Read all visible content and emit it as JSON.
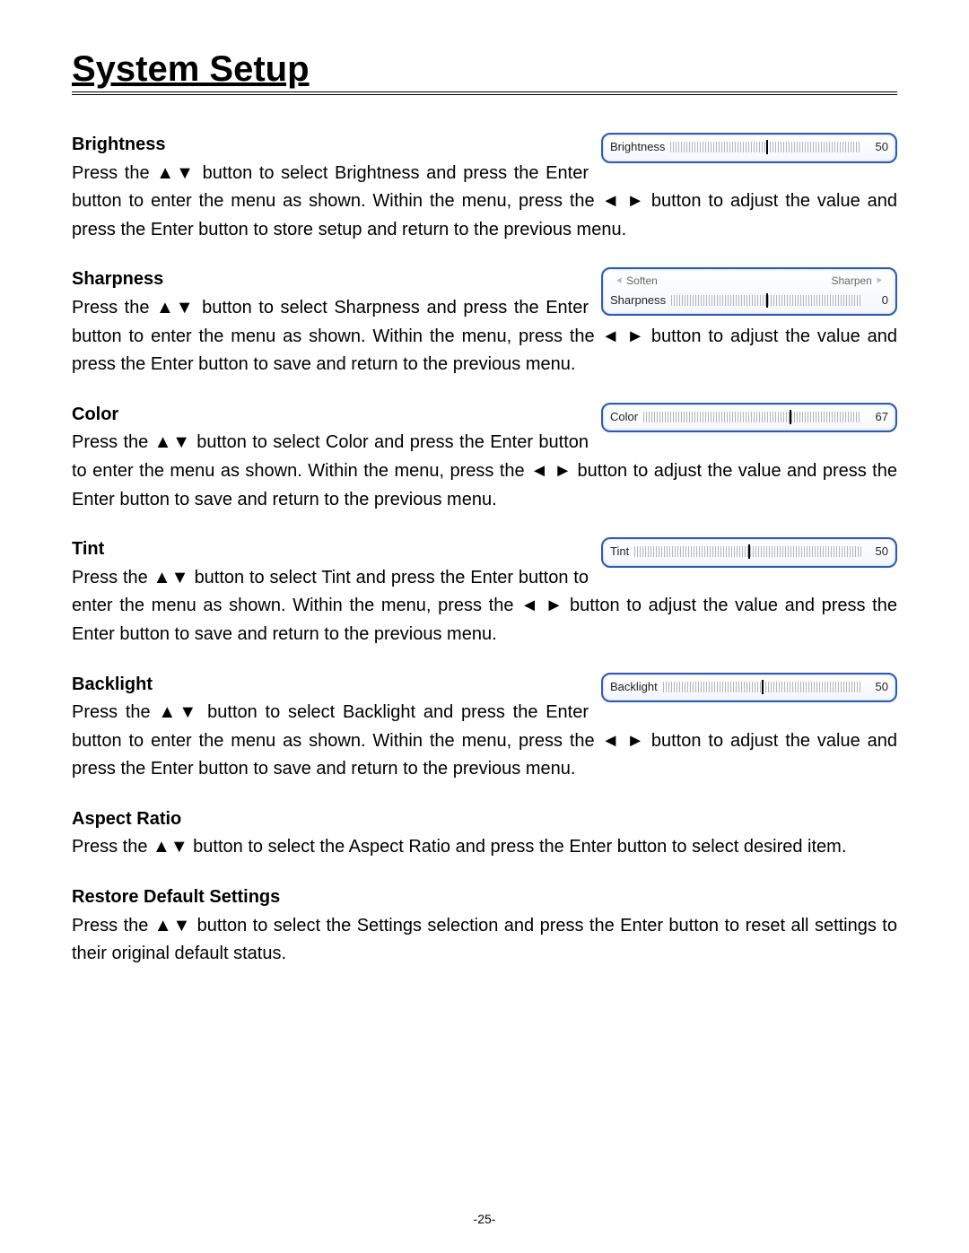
{
  "page_title": "System Setup",
  "footer": "-25-",
  "sections": {
    "brightness": {
      "heading": "Brightness",
      "text_a": "Press the ▲▼ button to select Brightness and press the Enter button to enter the menu as shown. Within the ",
      "text_b": "menu, press the ◄ ► button to adjust the value and press the Enter button to store setup and return to the previous menu."
    },
    "sharpness": {
      "heading": "Sharpness",
      "text_a": "Press the ▲▼ button to select Sharpness and press the Enter button to enter the menu as shown. Within the ",
      "text_b": "menu, press the ◄ ► button to adjust the value and press the Enter button to save and return to the previous menu."
    },
    "color": {
      "heading": "Color",
      "text_a": "Press the ▲▼ button to select Color and press the Enter button to enter the menu as shown. Within the menu, ",
      "text_b": "press the ◄ ► button to adjust the value and press the Enter button to save and return to the previous menu."
    },
    "tint": {
      "heading": "Tint",
      "text_a": "Press the ▲▼ button to select Tint and press the Enter button to enter the menu as shown. Within the menu, ",
      "text_b": "press the ◄ ► button to adjust the value and press the Enter button to save and return to the previous menu."
    },
    "backlight": {
      "heading": "Backlight",
      "text_a": "Press the ▲▼ button to select Backlight and press the Enter button to enter the menu as shown. Within the ",
      "text_b": "menu, press the ◄ ► button to adjust the value and press the Enter button to save and return to the previous menu."
    },
    "aspect": {
      "heading": "Aspect Ratio",
      "text": "Press the ▲▼ button to select the Aspect Ratio and press the Enter button to select desired item."
    },
    "restore": {
      "heading": "Restore Default Settings",
      "text": "Press the ▲▼ button to select the Settings selection and press the Enter button to reset all settings to their original default status."
    }
  },
  "osd": {
    "brightness": {
      "label": "Brightness",
      "value": "50",
      "pct": 50
    },
    "sharpness": {
      "label": "Sharpness",
      "left": "Soften",
      "right": "Sharpen",
      "value": "0",
      "pct": 50
    },
    "color": {
      "label": "Color",
      "value": "67",
      "pct": 67
    },
    "tint": {
      "label": "Tint",
      "value": "50",
      "pct": 50
    },
    "backlight": {
      "label": "Backlight",
      "value": "50",
      "pct": 50
    }
  }
}
